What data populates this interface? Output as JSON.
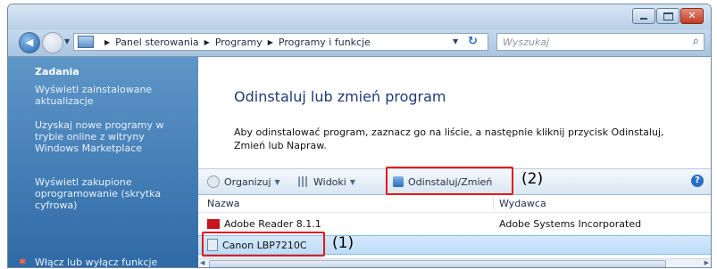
{
  "address": {
    "segments": [
      "Panel sterowania",
      "Programy",
      "Programy i funkcje"
    ],
    "search_placeholder": "Wyszukaj"
  },
  "sidebar": {
    "title": "Zadania",
    "items": [
      "Wyświetl zainstalowane aktualizacje",
      "Uzyskaj nowe programy w trybie online z witryny Windows Marketplace",
      "Wyświetl zakupione oprogramowanie (skrytka cyfrowa)",
      "Włącz lub wyłącz funkcje"
    ]
  },
  "main": {
    "heading": "Odinstaluj lub zmień program",
    "description": "Aby odinstalować program, zaznacz go na liście, a następnie kliknij przycisk Odinstaluj, Zmień lub Napraw."
  },
  "toolbar": {
    "organize": "Organizuj",
    "views": "Widoki",
    "uninstall_change": "Odinstaluj/Zmień",
    "help": "?"
  },
  "list": {
    "columns": [
      "Nazwa",
      "Wydawca"
    ],
    "rows": [
      {
        "name": "Adobe Reader 8.1.1",
        "publisher": "Adobe Systems Incorporated"
      },
      {
        "name": "Canon LBP7210C",
        "publisher": ""
      }
    ]
  },
  "callouts": [
    "(1)",
    "(2)"
  ],
  "colors": {
    "sidebar": "#3e7bb6",
    "highlight_box": "#e11a1a",
    "heading": "#1f3a78",
    "selected_row": "#c9e3f9"
  }
}
